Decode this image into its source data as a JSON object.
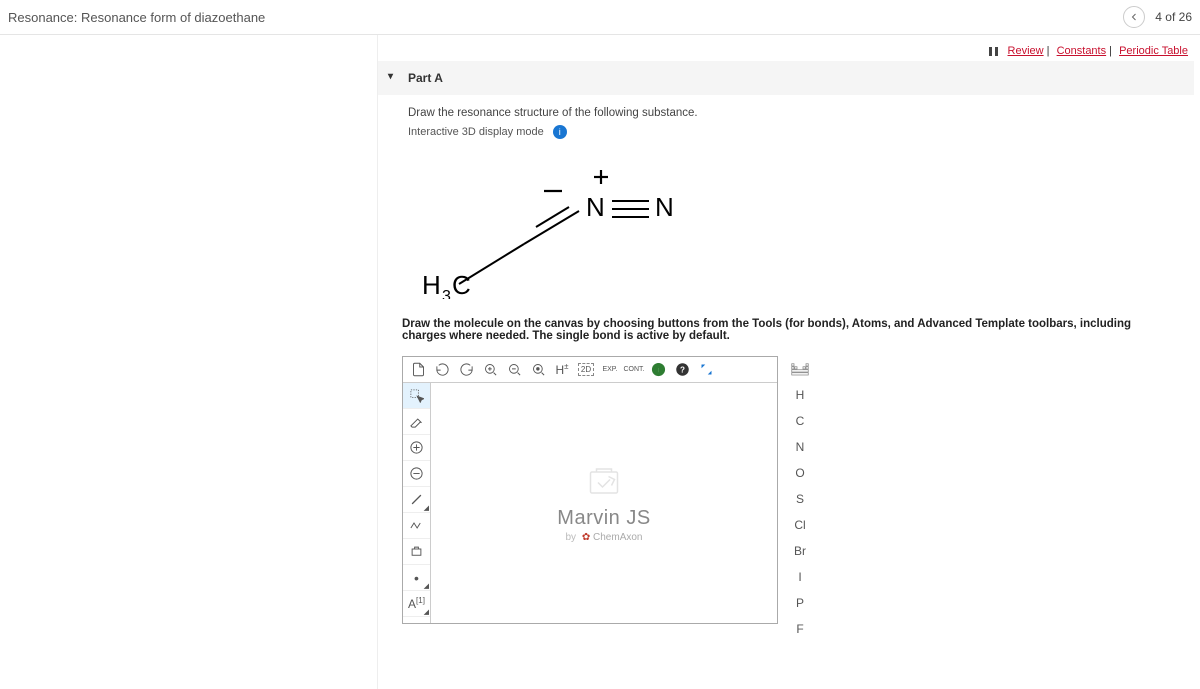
{
  "header": {
    "title": "Resonance: Resonance form of diazoethane",
    "progress": "4 of 26"
  },
  "links": {
    "review": "Review",
    "constants": "Constants",
    "periodic": "Periodic Table"
  },
  "part": {
    "label": "Part A",
    "instruction": "Draw the resonance structure of the following substance.",
    "mode": "Interactive 3D display mode"
  },
  "hint": "Draw the molecule on the canvas by choosing buttons from the Tools (for bonds), Atoms, and Advanced Template toolbars, including charges where needed. The single bond is active by default.",
  "editor": {
    "brand": "Marvin JS",
    "vendor_by": "by",
    "vendor": "ChemAxon",
    "top_tools": {
      "h_label": "H",
      "twod": "2D",
      "exp": "EXP.",
      "cont": "CONT."
    },
    "left_tools": {
      "mapping": "A"
    },
    "atoms": [
      "H",
      "C",
      "N",
      "O",
      "S",
      "Cl",
      "Br",
      "I",
      "P",
      "F"
    ]
  }
}
